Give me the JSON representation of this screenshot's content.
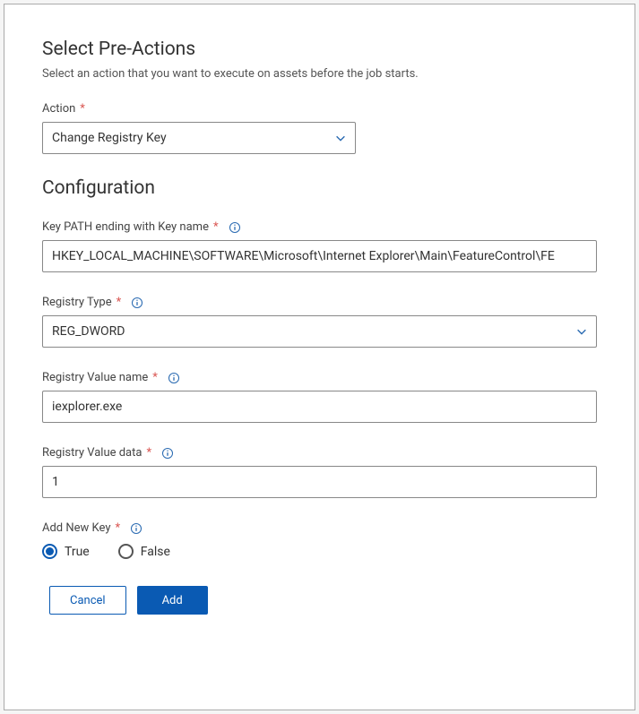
{
  "header": {
    "title": "Select Pre-Actions",
    "subtitle": "Select an action that you want to execute on assets before the job starts."
  },
  "action": {
    "label": "Action",
    "value": "Change Registry Key"
  },
  "config": {
    "title": "Configuration",
    "keyPath": {
      "label": "Key PATH ending with Key name",
      "value": "HKEY_LOCAL_MACHINE\\SOFTWARE\\Microsoft\\Internet Explorer\\Main\\FeatureControl\\FE"
    },
    "registryType": {
      "label": "Registry Type",
      "value": "REG_DWORD"
    },
    "registryValueName": {
      "label": "Registry Value name",
      "value": "iexplorer.exe"
    },
    "registryValueData": {
      "label": "Registry Value data",
      "value": "1"
    },
    "addNewKey": {
      "label": "Add New Key",
      "selected": "true",
      "optionTrue": "True",
      "optionFalse": "False"
    }
  },
  "buttons": {
    "cancel": "Cancel",
    "add": "Add"
  }
}
